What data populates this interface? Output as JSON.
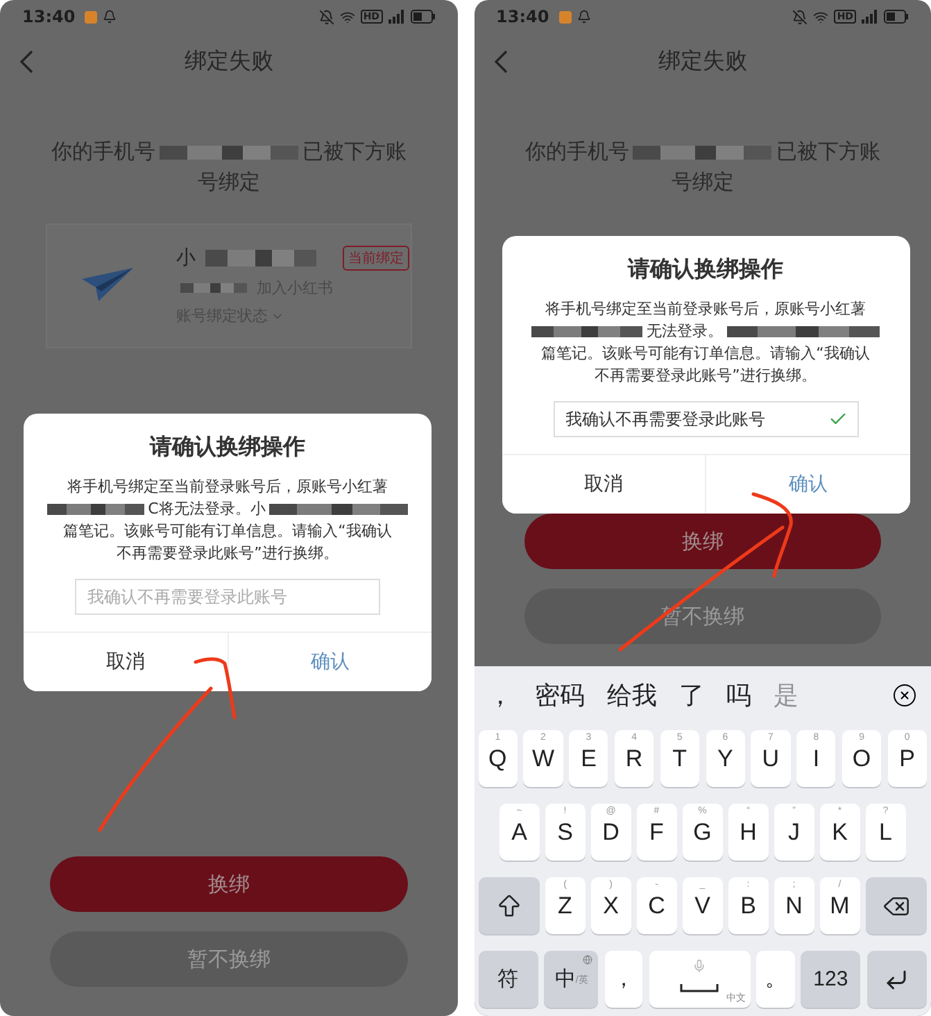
{
  "screens": [
    {
      "status_bar": {
        "time": "13:40",
        "network": "HD"
      },
      "nav": {
        "title": "绑定失败"
      },
      "message": {
        "prefix": "你的手机号",
        "suffix": "已被下方账",
        "continuation": "号绑定"
      },
      "account_card": {
        "name_prefix": "小",
        "tag": "当前绑定",
        "joined": "加入小红书",
        "status_toggle": "账号绑定状态"
      },
      "dialog": {
        "title": "请确认换绑操作",
        "body": [
          {
            "text": "将手机号绑定至当前登录账号后，原账号小红薯"
          },
          {
            "text": "C将无法登录。小",
            "redacted_before": true,
            "redacted_after": true
          },
          {
            "text": "篇笔记。该账号可能有订单信息。请输入“我确认"
          },
          {
            "text": "不再需要登录此账号”进行换绑。"
          }
        ],
        "input": {
          "placeholder": "我确认不再需要登录此账号"
        },
        "buttons": [
          {
            "label": "取消",
            "kind": "cancel"
          },
          {
            "label": "确认",
            "kind": "confirm"
          }
        ]
      },
      "actions": [
        {
          "label": "换绑",
          "kind": "primary"
        },
        {
          "label": "暂不换绑",
          "kind": "secondary"
        }
      ]
    },
    {
      "status_bar": {
        "time": "13:40",
        "network": "HD"
      },
      "nav": {
        "title": "绑定失败"
      },
      "message": {
        "prefix": "你的手机号",
        "suffix": "已被下方账",
        "continuation": "号绑定"
      },
      "dialog": {
        "title": "请确认换绑操作",
        "body": [
          {
            "text": "将手机号绑定至当前登录账号后，原账号小红薯"
          },
          {
            "text": "无法登录。",
            "redacted_before": true,
            "redacted_after": true
          },
          {
            "text": "篇笔记。该账号可能有订单信息。请输入“我确认"
          },
          {
            "text": "不再需要登录此账号”进行换绑。"
          }
        ],
        "input": {
          "value": "我确认不再需要登录此账号",
          "valid": true
        },
        "buttons": [
          {
            "label": "取消",
            "kind": "cancel"
          },
          {
            "label": "确认",
            "kind": "confirm"
          }
        ]
      },
      "actions": [
        {
          "label": "换绑",
          "kind": "primary"
        },
        {
          "label": "暂不换绑",
          "kind": "secondary"
        }
      ],
      "keyboard": {
        "candidates": [
          "，",
          "密码",
          "给我",
          "了",
          "吗",
          "是"
        ],
        "rows": [
          {
            "keys": [
              {
                "kind": "letter",
                "label": "Q",
                "hint": "1"
              },
              {
                "kind": "letter",
                "label": "W",
                "hint": "2"
              },
              {
                "kind": "letter",
                "label": "E",
                "hint": "3"
              },
              {
                "kind": "letter",
                "label": "R",
                "hint": "4"
              },
              {
                "kind": "letter",
                "label": "T",
                "hint": "5"
              },
              {
                "kind": "letter",
                "label": "Y",
                "hint": "6"
              },
              {
                "kind": "letter",
                "label": "U",
                "hint": "7"
              },
              {
                "kind": "letter",
                "label": "I",
                "hint": "8"
              },
              {
                "kind": "letter",
                "label": "O",
                "hint": "9"
              },
              {
                "kind": "letter",
                "label": "P",
                "hint": "0"
              }
            ]
          },
          {
            "keys": [
              {
                "kind": "letter",
                "label": "A",
                "hint": "~"
              },
              {
                "kind": "letter",
                "label": "S",
                "hint": "!"
              },
              {
                "kind": "letter",
                "label": "D",
                "hint": "@"
              },
              {
                "kind": "letter",
                "label": "F",
                "hint": "#"
              },
              {
                "kind": "letter",
                "label": "G",
                "hint": "%"
              },
              {
                "kind": "letter",
                "label": "H",
                "hint": "“"
              },
              {
                "kind": "letter",
                "label": "J",
                "hint": "”"
              },
              {
                "kind": "letter",
                "label": "K",
                "hint": "*"
              },
              {
                "kind": "letter",
                "label": "L",
                "hint": "?"
              }
            ]
          },
          {
            "keys": [
              {
                "kind": "shift"
              },
              {
                "kind": "letter",
                "label": "Z",
                "hint": "("
              },
              {
                "kind": "letter",
                "label": "X",
                "hint": ")"
              },
              {
                "kind": "letter",
                "label": "C",
                "hint": "-"
              },
              {
                "kind": "letter",
                "label": "V",
                "hint": "_"
              },
              {
                "kind": "letter",
                "label": "B",
                "hint": ":"
              },
              {
                "kind": "letter",
                "label": "N",
                "hint": ";"
              },
              {
                "kind": "letter",
                "label": "M",
                "hint": "/"
              },
              {
                "kind": "backspace"
              }
            ]
          },
          {
            "keys": [
              {
                "kind": "function",
                "label": "符"
              },
              {
                "kind": "lang",
                "label": "中",
                "sub": "/英"
              },
              {
                "kind": "char",
                "label": "，"
              },
              {
                "kind": "space",
                "sub": "中文"
              },
              {
                "kind": "char",
                "label": "。"
              },
              {
                "kind": "function",
                "label": "123"
              },
              {
                "kind": "enter"
              }
            ]
          }
        ]
      }
    }
  ]
}
